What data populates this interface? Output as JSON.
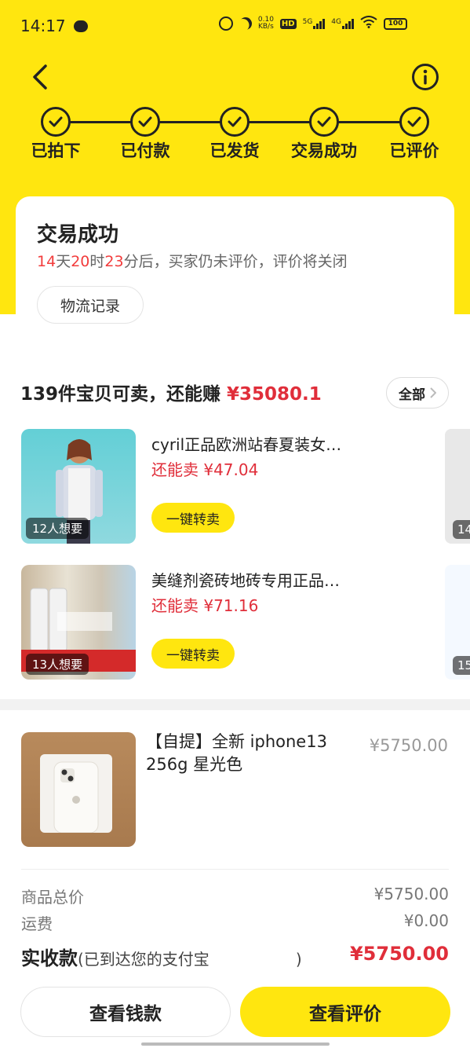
{
  "status_bar": {
    "time": "14:17",
    "net_speed": "0.10\nKB/s",
    "hd": "HD",
    "signal_5g": "5G",
    "signal_4g": "4G",
    "battery": "100"
  },
  "colors": {
    "accent_yellow": "#ffe60f",
    "price_red": "#e02e3a",
    "countdown_red": "#f23c3c"
  },
  "nav": {
    "back_icon": "back-arrow-icon",
    "info_icon": "info-icon"
  },
  "progress": {
    "steps": [
      {
        "label": "已拍下",
        "done": true
      },
      {
        "label": "已付款",
        "done": true
      },
      {
        "label": "已发货",
        "done": true
      },
      {
        "label": "交易成功",
        "done": true
      },
      {
        "label": "已评价",
        "done": true
      }
    ]
  },
  "status_card": {
    "title": "交易成功",
    "countdown": {
      "d": "14",
      "d_unit": "天",
      "h": "20",
      "h_unit": "时",
      "m": "23",
      "m_unit": "分后，买家仍未评价，评价将关闭"
    },
    "logistics_button": "物流记录"
  },
  "resale": {
    "title_prefix": "139件宝贝可卖，还能赚",
    "title_amount": "¥35080.1",
    "all_button": "全部",
    "items": [
      {
        "name": "cyril正品欧洲站春夏装女…",
        "price": "还能卖 ¥47.04",
        "want": "12人想要",
        "button": "一键转卖",
        "peek_badge": "14"
      },
      {
        "name": "美缝剂瓷砖地砖专用正品…",
        "price": "还能卖 ¥71.16",
        "want": "13人想要",
        "button": "一键转卖",
        "peek_badge": "15"
      }
    ]
  },
  "order": {
    "name": "【自提】全新 iphone13 256g 星光色",
    "price": "¥5750.00",
    "subtotal_label": "商品总价",
    "subtotal_value": "¥5750.00",
    "shipping_label": "运费",
    "shipping_value": "¥0.00",
    "total_label": "实收款",
    "total_note": "(已到达您的支付宝",
    "total_note_end": ")",
    "total_value": "¥5750.00"
  },
  "actions": {
    "view_money": "查看钱款",
    "view_review": "查看评价"
  }
}
